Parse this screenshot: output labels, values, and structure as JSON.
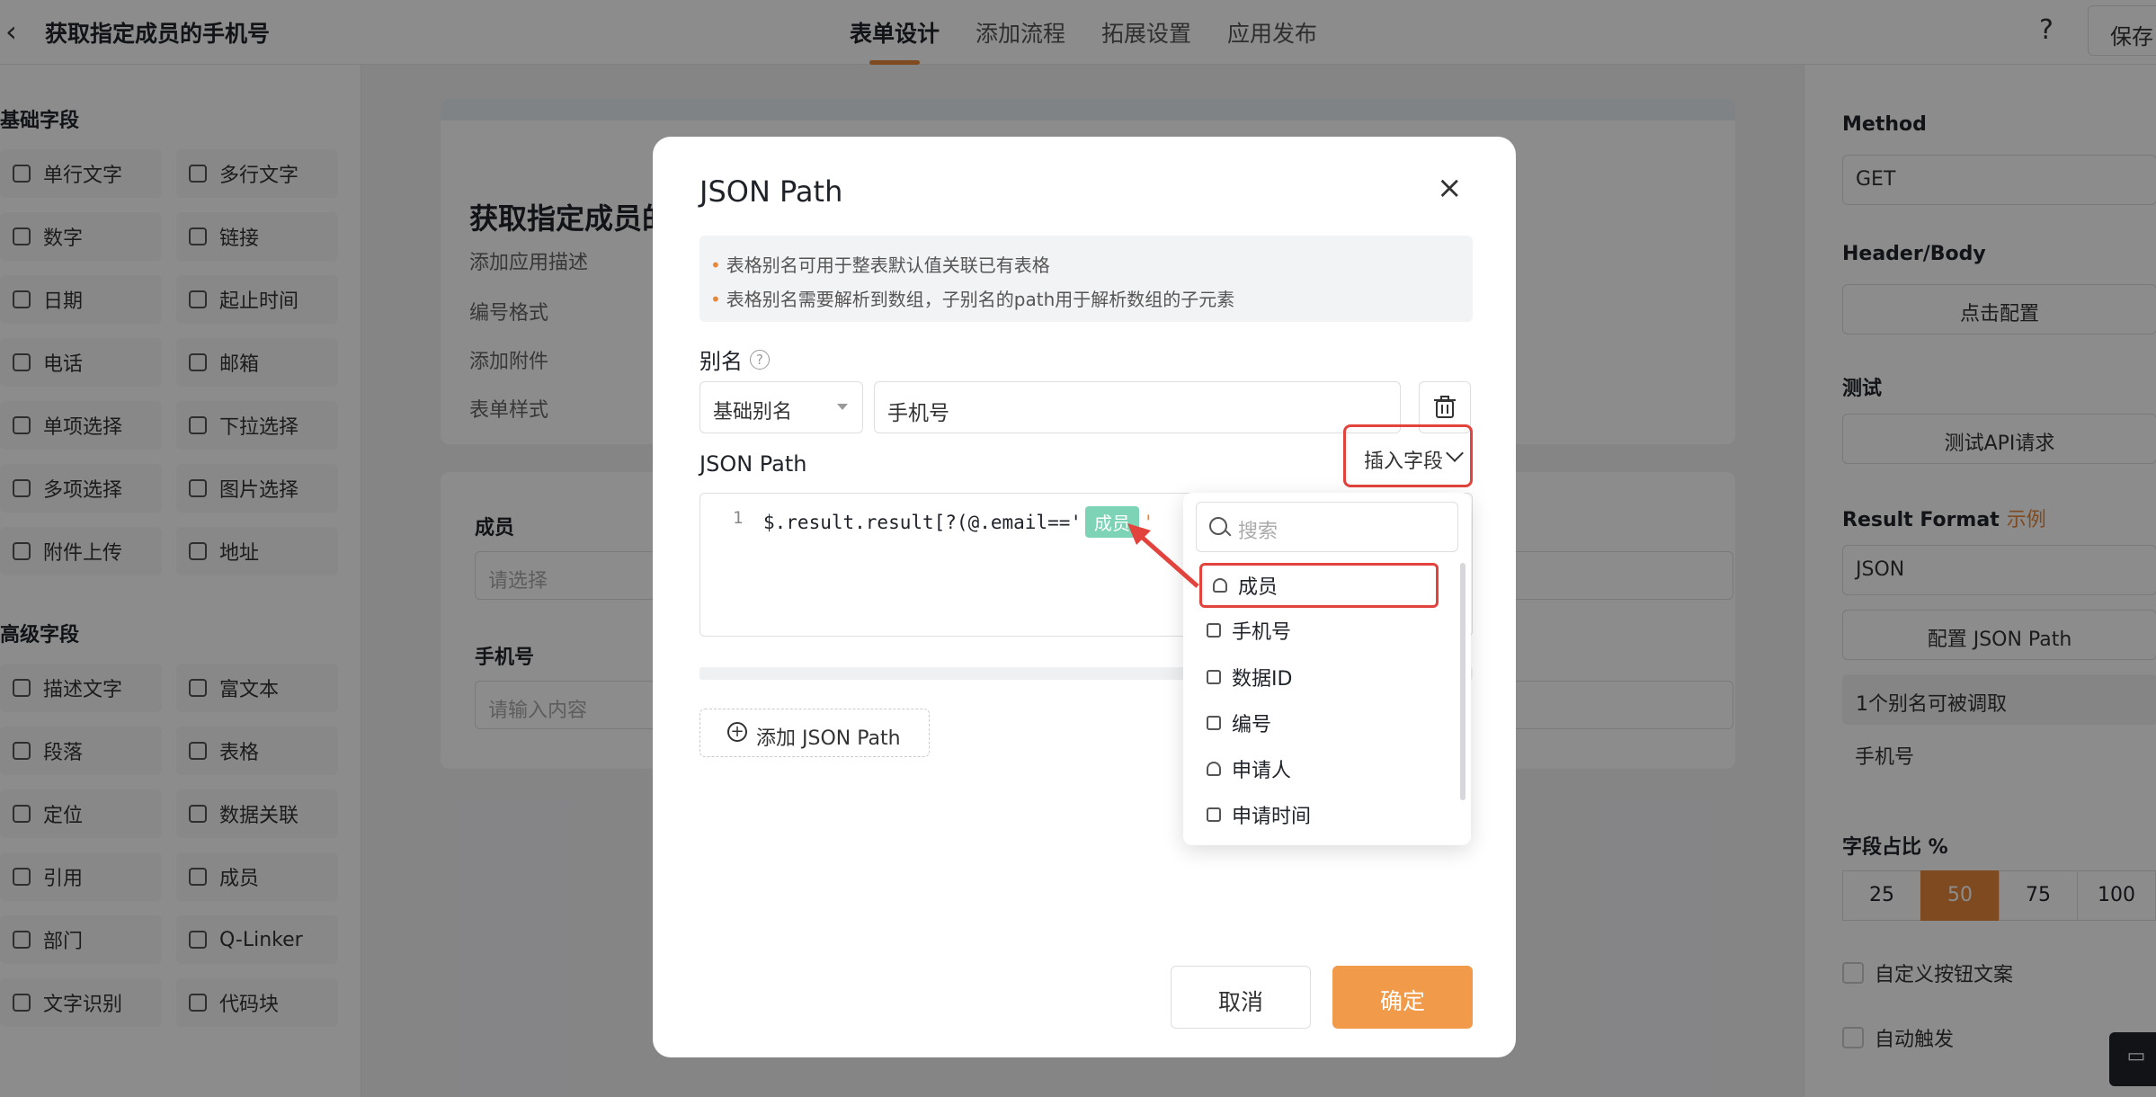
{
  "header": {
    "back_glyph": "‹",
    "title": "获取指定成员的手机号",
    "tabs": [
      "表单设计",
      "添加流程",
      "拓展设置",
      "应用发布"
    ],
    "help": "?",
    "save": "保存"
  },
  "left": {
    "basic_title": "基础字段",
    "basic_fields": [
      "单行文字",
      "多行文字",
      "数字",
      "链接",
      "日期",
      "起止时间",
      "电话",
      "邮箱",
      "单项选择",
      "下拉选择",
      "多项选择",
      "图片选择",
      "附件上传",
      "地址"
    ],
    "advanced_title": "高级字段",
    "advanced_fields": [
      "描述文字",
      "富文本",
      "段落",
      "表格",
      "定位",
      "数据关联",
      "引用",
      "成员",
      "部门",
      "Q-Linker",
      "文字识别",
      "代码块"
    ]
  },
  "canvas": {
    "form_title": "获取指定成员的",
    "meta": [
      "添加应用描述",
      "编号格式",
      "添加附件",
      "表单样式"
    ],
    "member_label": "成员",
    "member_placeholder": "请选择",
    "phone_label": "手机号",
    "phone_placeholder": "请输入内容"
  },
  "right": {
    "method_label": "Method",
    "method_value": "GET",
    "header_body_label": "Header/Body",
    "header_body_btn": "点击配置",
    "test_label": "测试",
    "test_btn": "测试API请求",
    "result_format_label": "Result Format",
    "result_format_link": "示例",
    "result_format_value": "JSON",
    "config_jsonpath_btn": "配置 JSON Path",
    "alias_count": "1个别名可被调取",
    "alias_item": "手机号",
    "ratio_label": "字段占比 %",
    "ratios": [
      "25",
      "50",
      "75",
      "100"
    ],
    "custom_btn_text": "自定义按钮文案",
    "auto_trigger": "自动触发"
  },
  "modal": {
    "title": "JSON Path",
    "close": "×",
    "tips": [
      "表格别名可用于整表默认值关联已有表格",
      "表格别名需要解析到数组，子别名的path用于解析数组的子元素"
    ],
    "alias_label": "别名",
    "alias_type": "基础别名",
    "alias_value": "手机号",
    "jsonpath_label": "JSON Path",
    "insert_field": "插入字段",
    "code_line_no": "1",
    "code_prefix": "$.result.result[?(@.email=='",
    "code_chip": "成员",
    "code_suffix": "'",
    "add_jsonpath": "添加 JSON Path",
    "cancel": "取消",
    "ok": "确定"
  },
  "dropdown": {
    "search_placeholder": "搜索",
    "items": [
      "成员",
      "手机号",
      "数据ID",
      "编号",
      "申请人",
      "申请时间"
    ]
  }
}
